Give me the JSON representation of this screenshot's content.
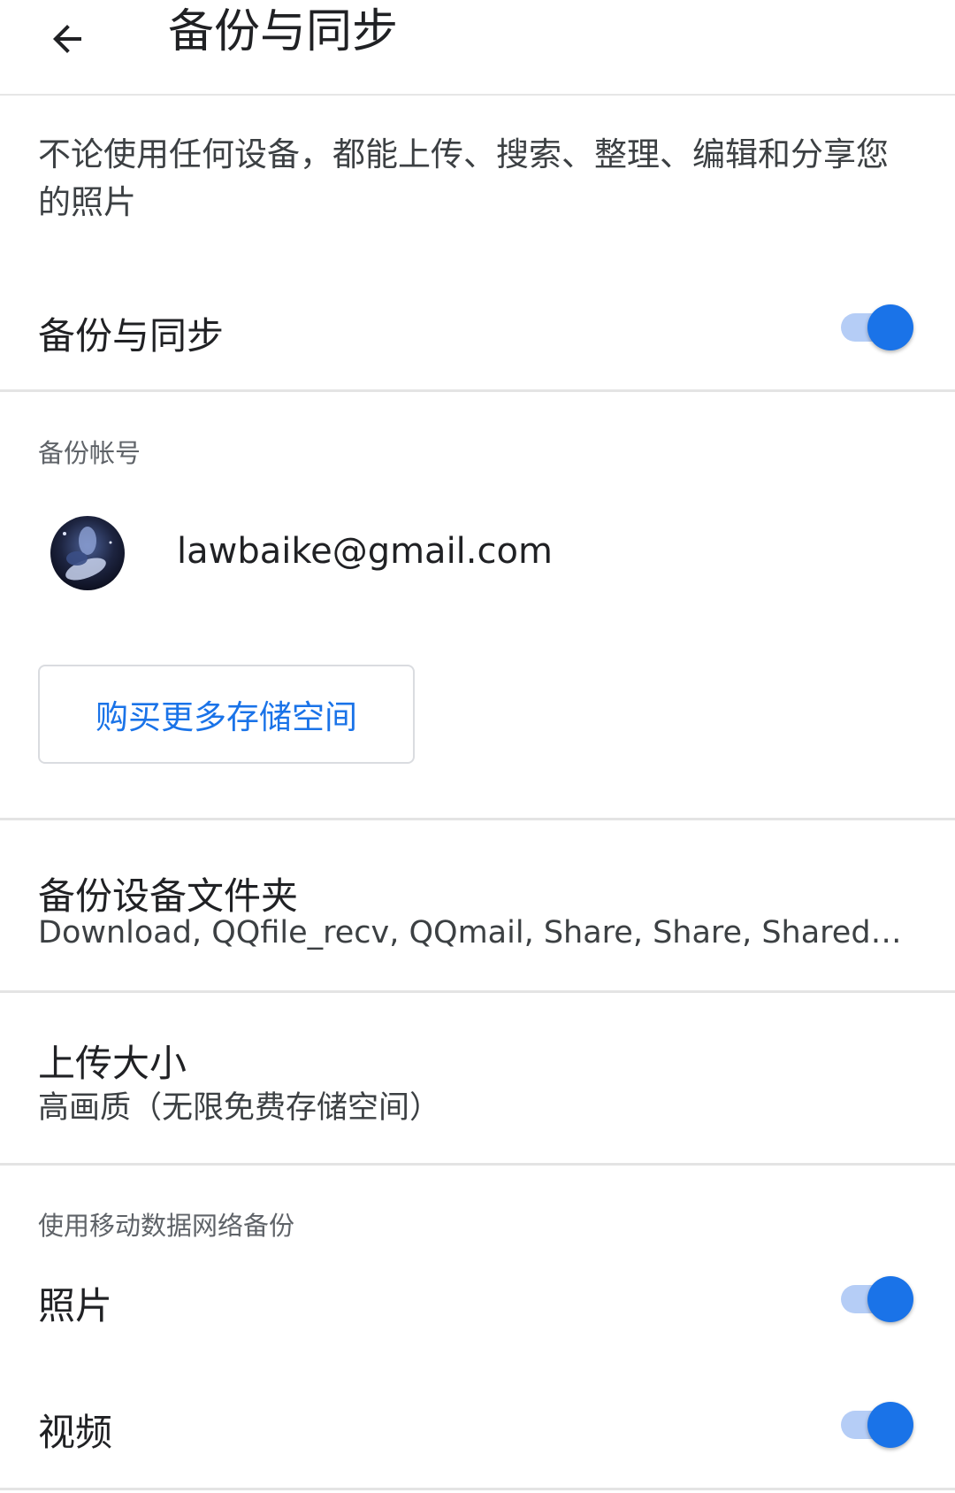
{
  "appbar": {
    "title": "备份与同步",
    "back_icon": "arrow-back-icon"
  },
  "intro": {
    "text": "不论使用任何设备，都能上传、搜索、整理、编辑和分享您的照片"
  },
  "backup_sync": {
    "label": "备份与同步",
    "enabled": true
  },
  "account": {
    "header": "备份帐号",
    "email": "lawbaike@gmail.com",
    "buy_storage_label": "购买更多存储空间"
  },
  "folders": {
    "label": "备份设备文件夹",
    "value": "Download, QQfile_recv, QQmail, Share, Share, SharedFiles, T..."
  },
  "upload_size": {
    "label": "上传大小",
    "value": "高画质（无限免费存储空间）"
  },
  "mobile_data": {
    "header": "使用移动数据网络备份",
    "photos_label": "照片",
    "photos_enabled": true,
    "videos_label": "视频",
    "videos_enabled": true
  },
  "colors": {
    "accent": "#1a73e8",
    "switch_track": "#b5cdf6",
    "divider": "#e4e4e4"
  }
}
